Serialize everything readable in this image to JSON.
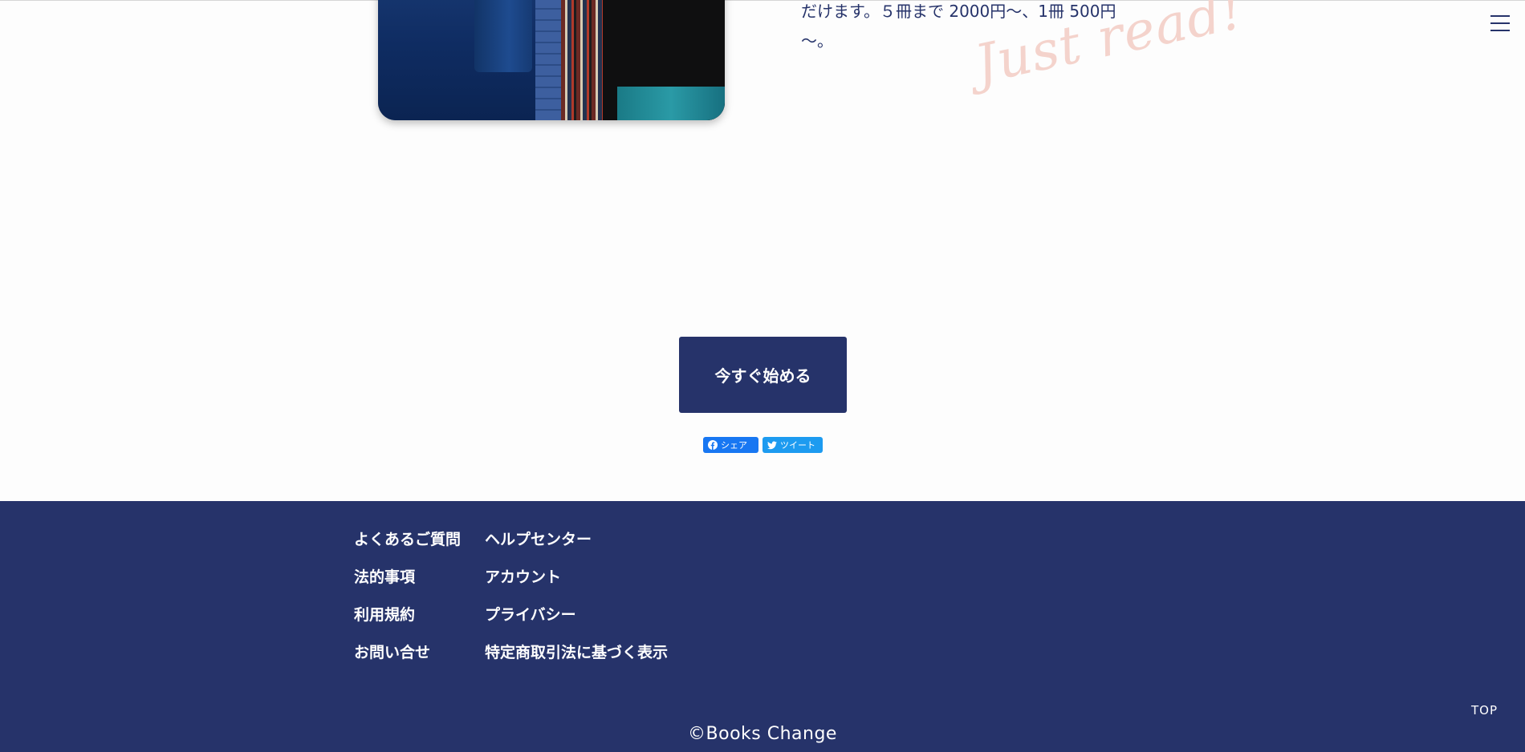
{
  "intro": {
    "line1": "だけます。５冊まで 2000円〜、1冊 500円",
    "line2": "〜。",
    "script_text": "Just read!"
  },
  "menu": {
    "icon": "hamburger-menu-icon"
  },
  "cta": {
    "label": "今すぐ始める"
  },
  "share": {
    "facebook_label": "シェア",
    "twitter_label": "ツイート"
  },
  "footer": {
    "links_col1": [
      "よくあるご質問",
      "法的事項",
      "利用規約",
      "お問い合せ"
    ],
    "links_col2": [
      "ヘルプセンター",
      "アカウント",
      "プライバシー",
      "特定商取引法に基づく表示"
    ],
    "top_label": "TOP",
    "copyright": "©Books Change"
  },
  "colors": {
    "brand_navy": "#26336a",
    "script_pink": "#f4d3cc",
    "facebook_blue": "#1877f2",
    "twitter_blue": "#1d9bf0"
  }
}
